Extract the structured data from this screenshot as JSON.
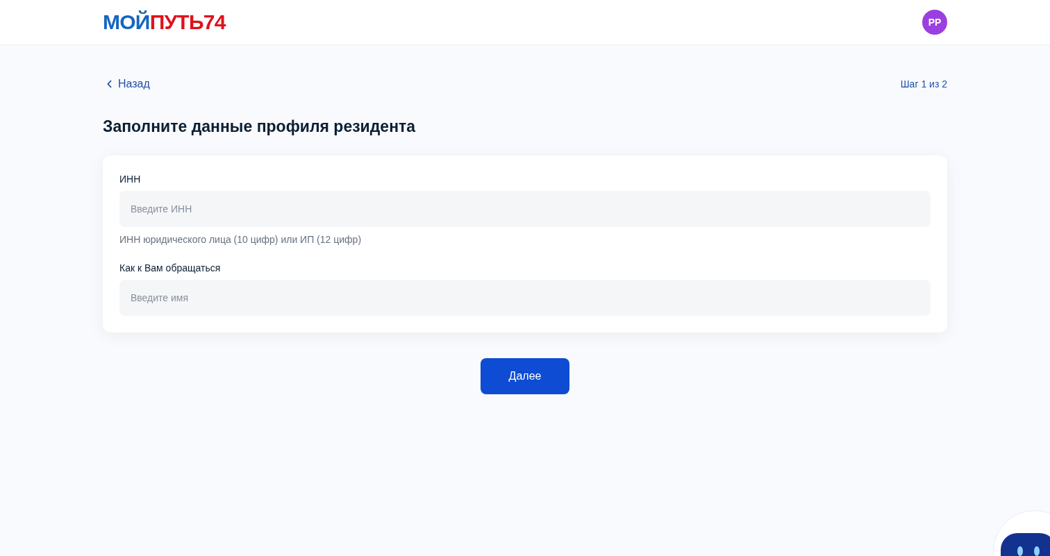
{
  "header": {
    "logo": [
      {
        "text": "МОЙ",
        "color": "#1565c0"
      },
      {
        "text": "ПУТЬ74",
        "color": "#e0111b"
      }
    ],
    "avatar": "РР"
  },
  "back_link": "Назад",
  "step": "Шаг 1 из 2",
  "title": "Заполните данные профиля резидента",
  "fields": [
    {
      "label": "ИНН",
      "placeholder": "Введите ИНН",
      "hint": "ИНН юридического лица (10 цифр) или ИП (12 цифр)"
    },
    {
      "label": "Как к Вам обращаться",
      "placeholder": "Введите имя"
    }
  ],
  "next_button": "Далее"
}
